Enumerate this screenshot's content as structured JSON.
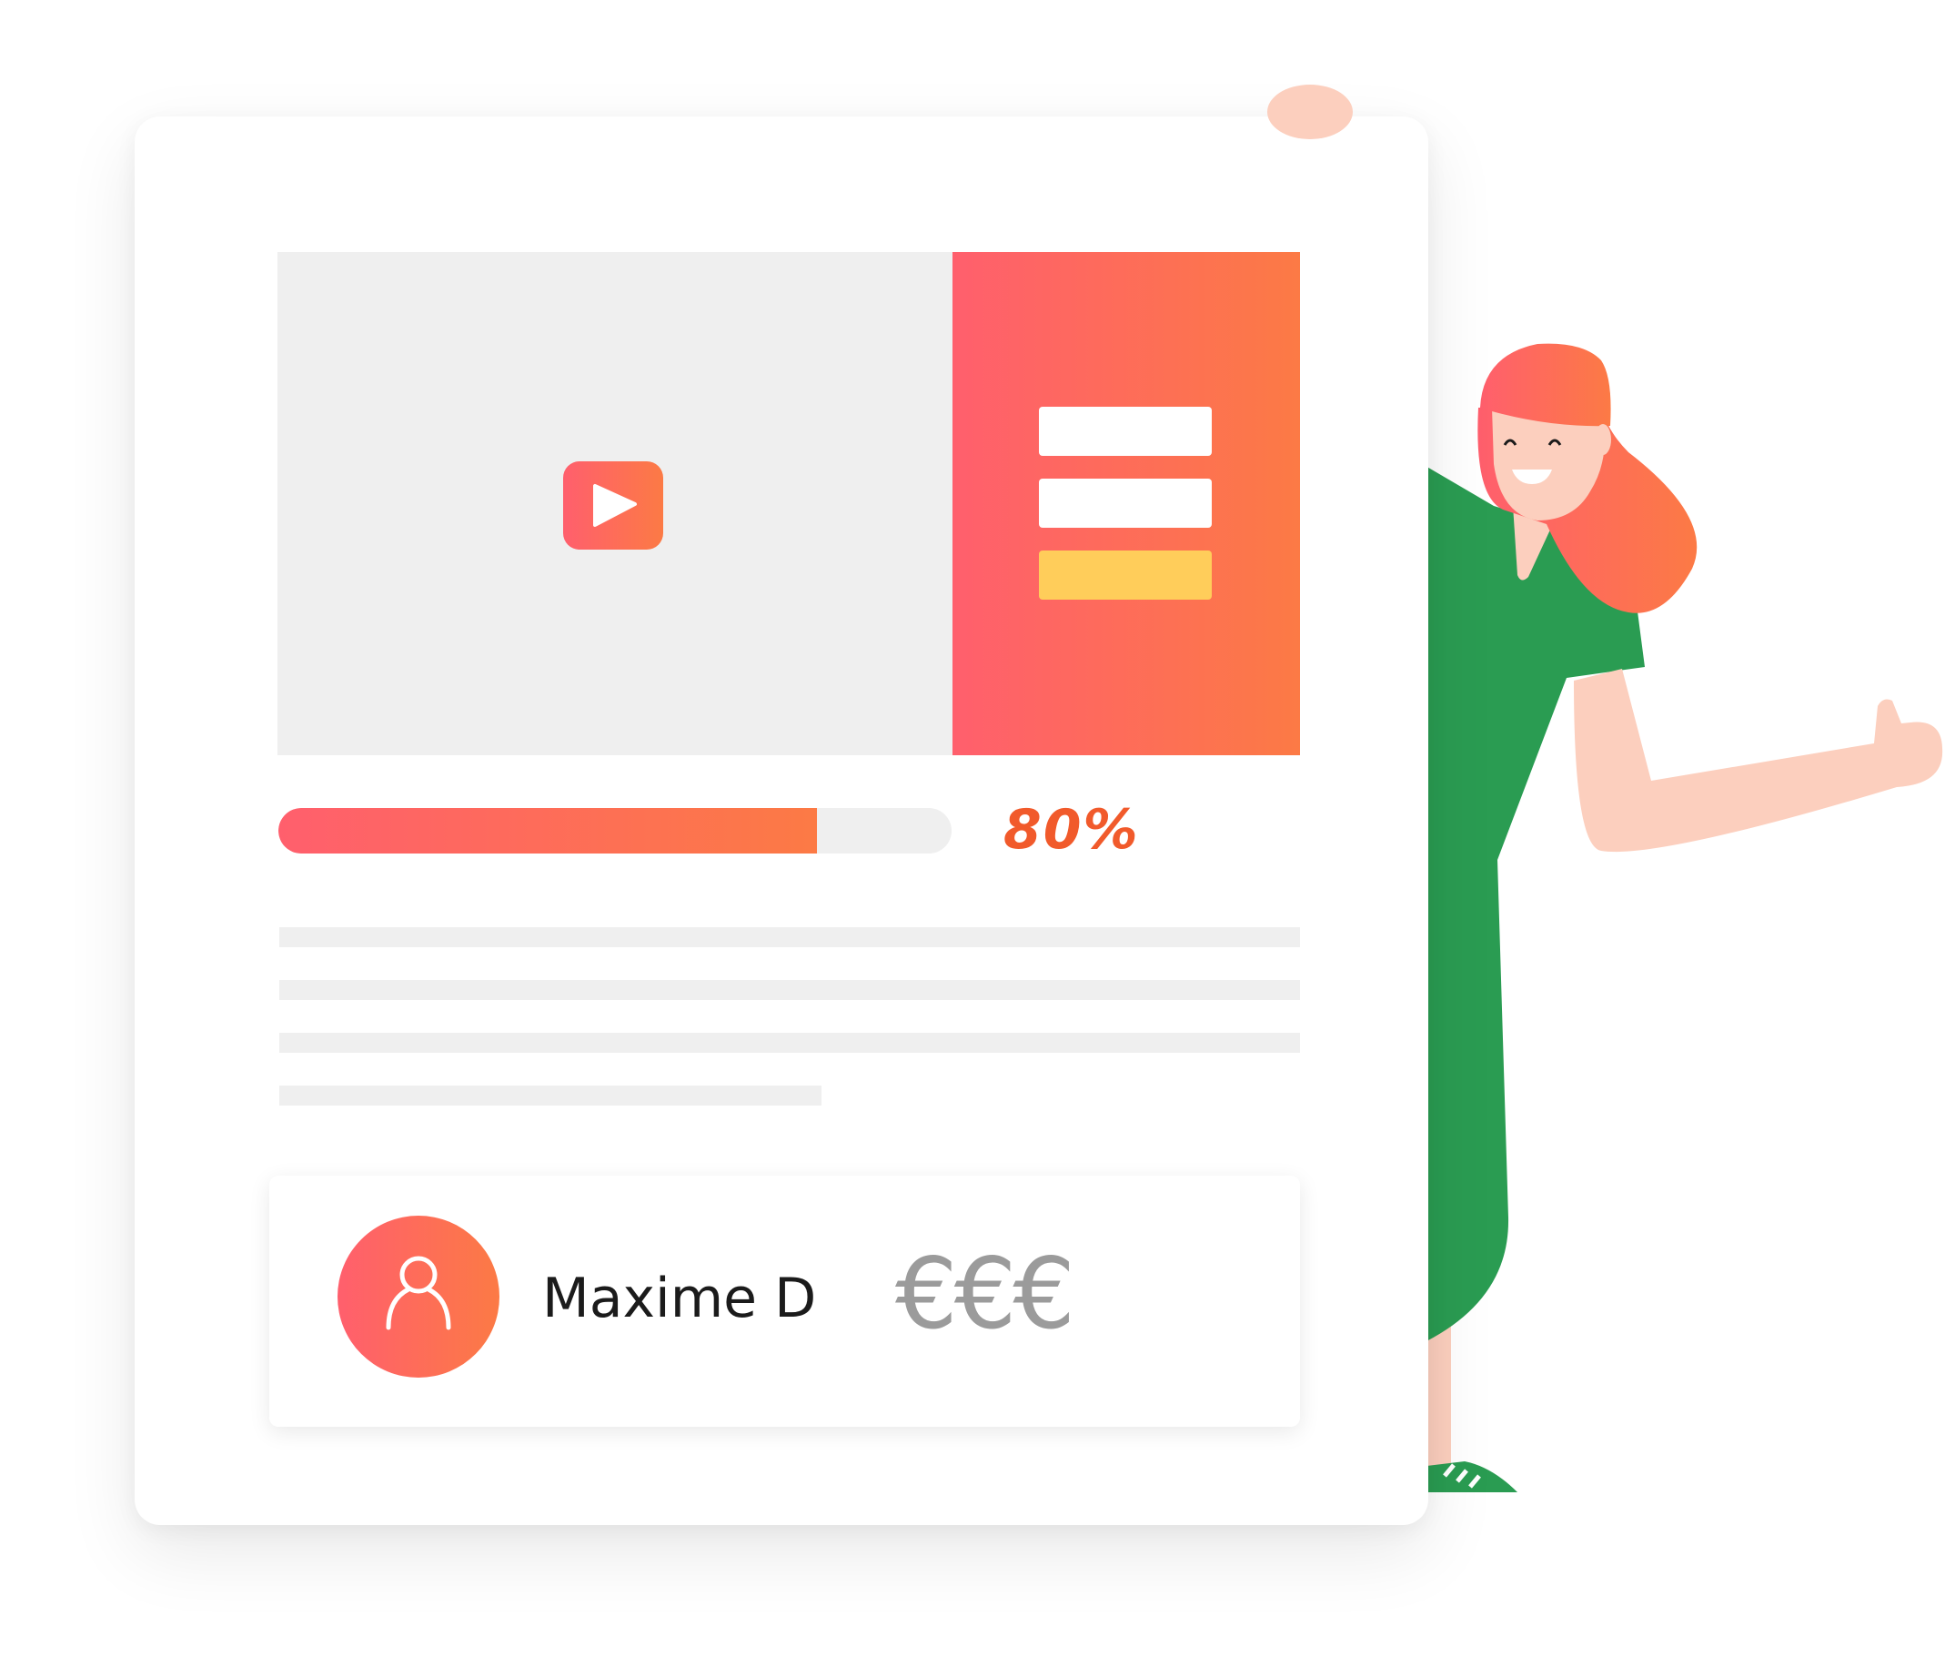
{
  "hero": {
    "play_icon": "play-icon",
    "form": {
      "field_count": 2,
      "submit_color": "#FFCD5A"
    }
  },
  "progress": {
    "percent": 80,
    "label": "80%",
    "label_color": "#F15A2B"
  },
  "profile": {
    "avatar_icon": "user-icon",
    "name": "Maxime D",
    "price_level": "€€€"
  },
  "theme": {
    "gradient_start": "#FF5F6D",
    "gradient_end": "#FC7A45",
    "placeholder": "#EFEFEF",
    "character_dress": "#2A9C52",
    "character_skin": "#FCCFBE"
  }
}
